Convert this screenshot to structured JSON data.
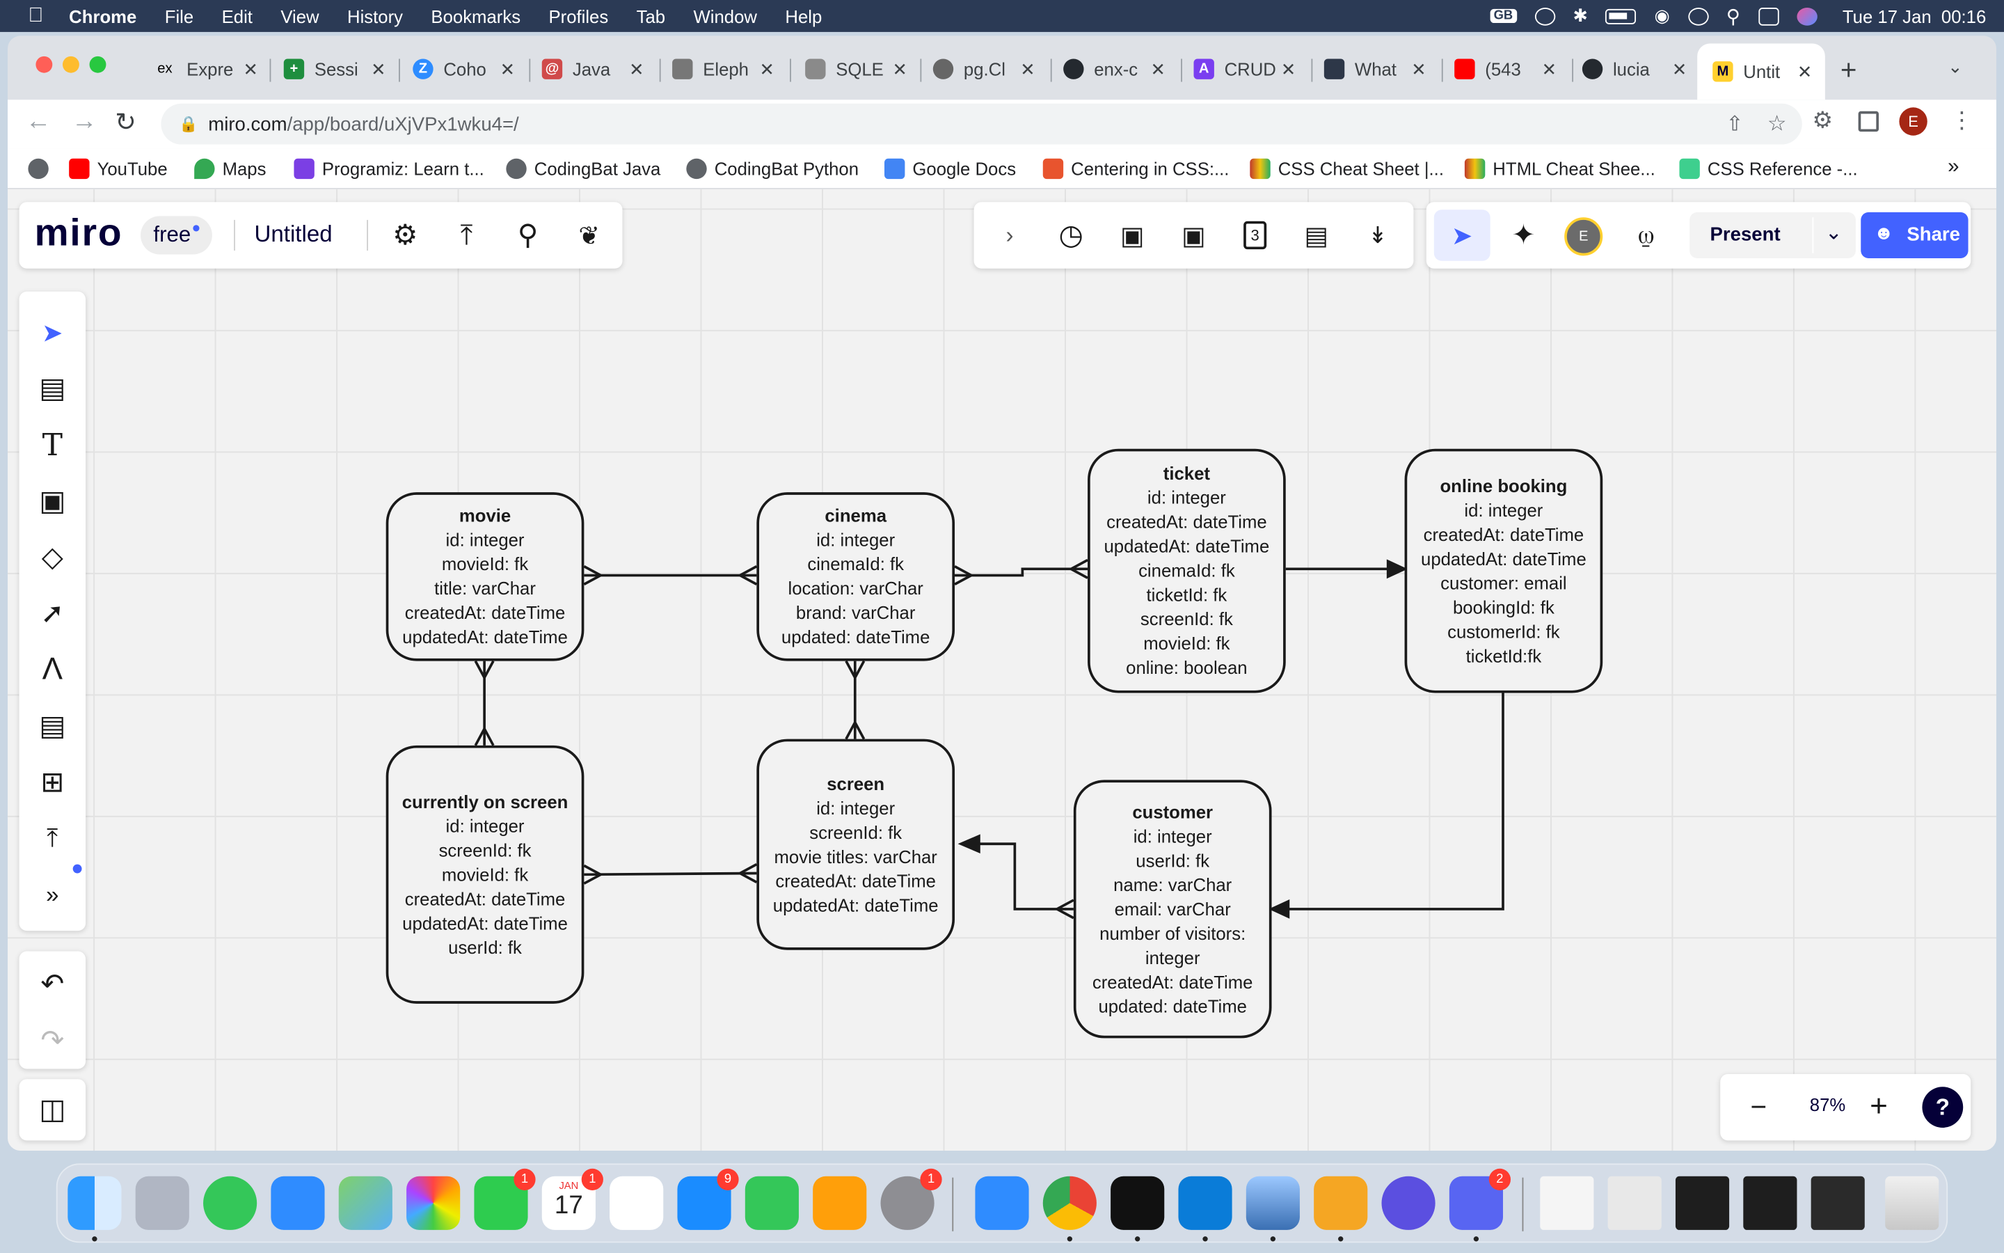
{
  "menubar": {
    "app": "Chrome",
    "items": [
      "File",
      "Edit",
      "View",
      "History",
      "Bookmarks",
      "Profiles",
      "Tab",
      "Window",
      "Help"
    ],
    "datetime": "Tue 17 Jan  00:16",
    "keyboard": "GB"
  },
  "tabs": [
    {
      "label": "Expre",
      "favicon": "ex"
    },
    {
      "label": "Sessi",
      "favicon": "+"
    },
    {
      "label": "Coho",
      "favicon": "Z"
    },
    {
      "label": "Java",
      "favicon": "@"
    },
    {
      "label": "Eleph",
      "favicon": ""
    },
    {
      "label": "SQLE",
      "favicon": ""
    },
    {
      "label": "pg.Cl",
      "favicon": ""
    },
    {
      "label": "enx-c",
      "favicon": ""
    },
    {
      "label": "CRUD",
      "favicon": "A"
    },
    {
      "label": "What",
      "favicon": ""
    },
    {
      "label": "(543",
      "favicon": ""
    },
    {
      "label": "lucia",
      "favicon": ""
    },
    {
      "label": "Untit",
      "favicon": "M"
    }
  ],
  "address": {
    "host": "miro.com",
    "path": "/app/board/uXjVPx1wku4=/"
  },
  "profile_initial": "E",
  "bookmarks": [
    "YouTube",
    "Maps",
    "Programiz: Learn t...",
    "CodingBat Java",
    "CodingBat Python",
    "Google Docs",
    "Centering in CSS:...",
    "CSS Cheat Sheet |...",
    "HTML Cheat Shee...",
    "CSS Reference -..."
  ],
  "bookmarks_overflow": "»",
  "miro": {
    "logo": "miro",
    "plan": "free",
    "board_title": "Untitled",
    "present_label": "Present",
    "share_label": "Share",
    "avatar_initial": "E",
    "zoom": "87%",
    "timer_badge": "3",
    "help": "?"
  },
  "entities": {
    "movie": {
      "title": "movie",
      "fields": [
        "id: integer",
        "movieId: fk",
        "title: varChar",
        "createdAt: dateTime",
        "updatedAt: dateTime"
      ]
    },
    "cinema": {
      "title": "cinema",
      "fields": [
        "id: integer",
        "cinemaId: fk",
        "location: varChar",
        "brand: varChar",
        "updated: dateTime"
      ]
    },
    "ticket": {
      "title": "ticket",
      "fields": [
        "id: integer",
        "createdAt: dateTime",
        "updatedAt: dateTime",
        "cinemaId: fk",
        "ticketId: fk",
        "screenId: fk",
        "movieId: fk",
        "online: boolean"
      ]
    },
    "online_booking": {
      "title": "online booking",
      "fields": [
        "id: integer",
        "createdAt: dateTime",
        "updatedAt: dateTime",
        "customer: email",
        "bookingId: fk",
        "customerId: fk",
        "ticketId:fk"
      ]
    },
    "currently_on_screen": {
      "title": "currently on screen",
      "fields": [
        "id: integer",
        "screenId: fk",
        "movieId: fk",
        "createdAt: dateTime",
        "updatedAt: dateTime",
        "userId: fk"
      ]
    },
    "screen": {
      "title": "screen",
      "fields": [
        "id: integer",
        "screenId: fk",
        "movie titles: varChar",
        "createdAt: dateTime",
        "updatedAt: dateTime"
      ]
    },
    "customer": {
      "title": "customer",
      "fields": [
        "id: integer",
        "userId: fk",
        "name: varChar",
        "email: varChar",
        "number of visitors:",
        "integer",
        "createdAt: dateTime",
        "updated: dateTime"
      ]
    }
  },
  "dock_badges": {
    "facetime": "1",
    "calendar": "1",
    "appstore": "9",
    "settings": "1",
    "discord": "2"
  },
  "calendar_icon": {
    "month": "JAN",
    "day": "17"
  },
  "colors": {
    "miro_blue": "#4262ff",
    "menubar": "#2b3a55",
    "canvas": "#f2f2f2"
  }
}
